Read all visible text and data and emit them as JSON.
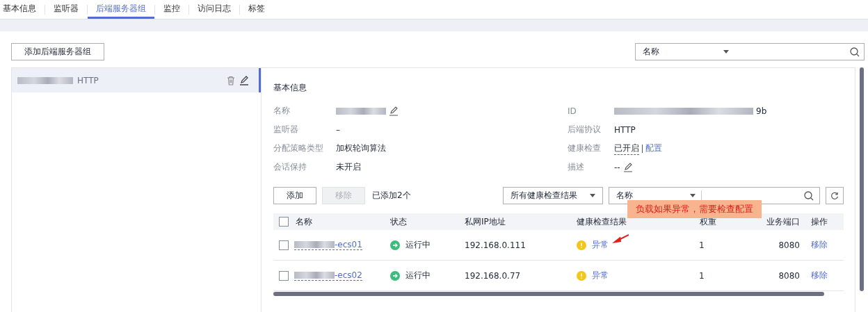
{
  "tabs": [
    {
      "label": "基本信息",
      "selected": false
    },
    {
      "label": "监听器",
      "selected": false
    },
    {
      "label": "后端服务器组",
      "selected": true
    },
    {
      "label": "监控",
      "selected": false
    },
    {
      "label": "访问日志",
      "selected": false
    },
    {
      "label": "标签",
      "selected": false
    }
  ],
  "add_group_button": "添加后端服务器组",
  "search": {
    "filter_option": "名称"
  },
  "groups": [
    {
      "name_suffix": "HTTP",
      "selected": true
    }
  ],
  "basic_info": {
    "title": "基本信息",
    "left_fields": [
      {
        "label": "名称",
        "kind": "redacted-edit"
      },
      {
        "label": "监听器",
        "kind": "text",
        "value": "–"
      },
      {
        "label": "分配策略类型",
        "kind": "text",
        "value": "加权轮询算法"
      },
      {
        "label": "会话保持",
        "kind": "text",
        "value": "未开启"
      }
    ],
    "right_fields": [
      {
        "label": "ID",
        "kind": "redacted",
        "value": "9b"
      },
      {
        "label": "后端协议",
        "kind": "text",
        "value": "HTTP"
      },
      {
        "label": "健康检查",
        "kind": "status-link",
        "value": "已开启",
        "link": "配置"
      },
      {
        "label": "描述",
        "kind": "edit",
        "value": "--"
      }
    ]
  },
  "toolbar": {
    "add_button": {
      "label": "添加",
      "disabled": false
    },
    "remove_button": {
      "label": "移除",
      "disabled": true
    },
    "count": "已添加2个",
    "health_filter": "所有健康检查结果",
    "name_filter": "名称"
  },
  "table": {
    "select_all_checked": false,
    "columns": [
      "名称",
      "状态",
      "私网IP地址",
      "健康检查结果",
      "权重",
      "业务端口",
      "操作"
    ],
    "rows": [
      {
        "checked": false,
        "name_suffix": "-ecs01",
        "status": "运行中",
        "ip": "192.168.0.111",
        "health": "异常",
        "weight": "1",
        "port": "8080",
        "action": "移除"
      },
      {
        "checked": false,
        "name_suffix": "-ecs02",
        "status": "运行中",
        "ip": "192.168.0.77",
        "health": "异常",
        "weight": "1",
        "port": "8080",
        "action": "移除"
      }
    ]
  },
  "callout": {
    "text": "负载如果异常，需要检查配置"
  }
}
